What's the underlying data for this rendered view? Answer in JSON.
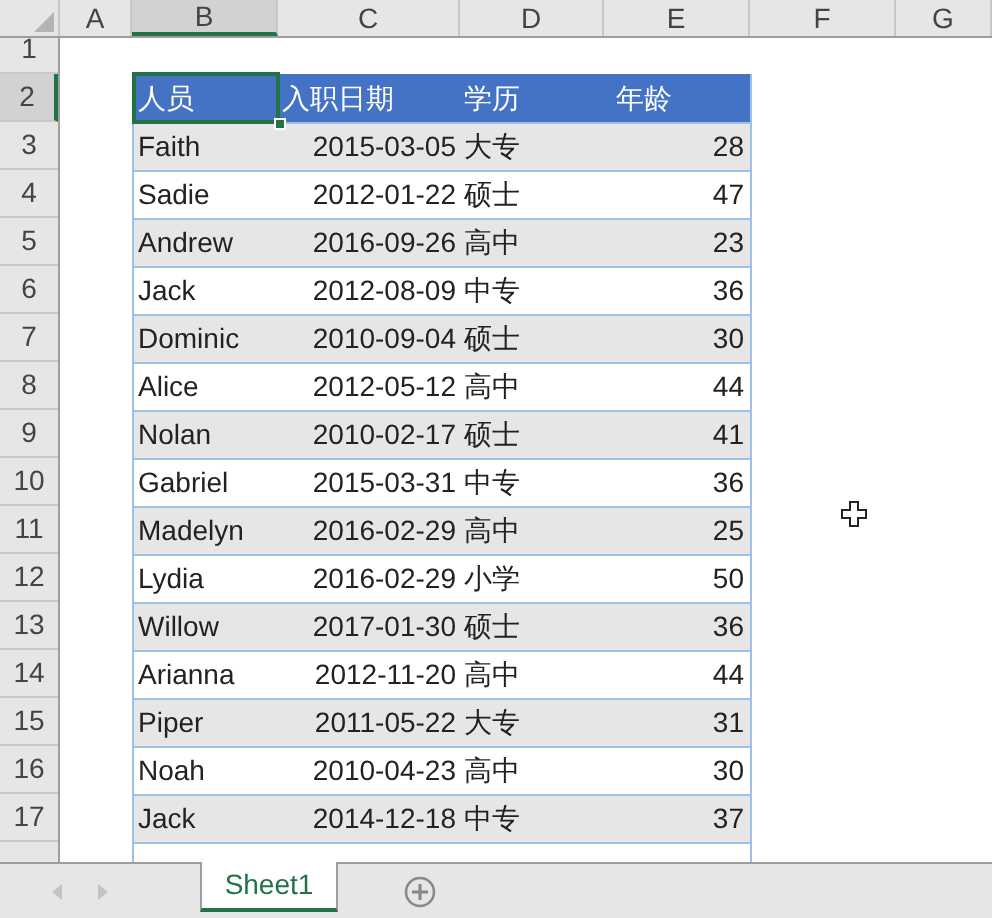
{
  "column_headers": [
    {
      "label": "A",
      "selected": false
    },
    {
      "label": "B",
      "selected": true
    },
    {
      "label": "C",
      "selected": false
    },
    {
      "label": "D",
      "selected": false
    },
    {
      "label": "E",
      "selected": false
    },
    {
      "label": "F",
      "selected": false
    },
    {
      "label": "G",
      "selected": false
    }
  ],
  "row_headers": [
    {
      "label": "1",
      "selected": false
    },
    {
      "label": "2",
      "selected": true
    },
    {
      "label": "3",
      "selected": false
    },
    {
      "label": "4",
      "selected": false
    },
    {
      "label": "5",
      "selected": false
    },
    {
      "label": "6",
      "selected": false
    },
    {
      "label": "7",
      "selected": false
    },
    {
      "label": "8",
      "selected": false
    },
    {
      "label": "9",
      "selected": false
    },
    {
      "label": "10",
      "selected": false
    },
    {
      "label": "11",
      "selected": false
    },
    {
      "label": "12",
      "selected": false
    },
    {
      "label": "13",
      "selected": false
    },
    {
      "label": "14",
      "selected": false
    },
    {
      "label": "15",
      "selected": false
    },
    {
      "label": "16",
      "selected": false
    },
    {
      "label": "17",
      "selected": false
    }
  ],
  "table": {
    "header": [
      {
        "text": "人员",
        "selected": true
      },
      {
        "text": "入职日期",
        "selected": false
      },
      {
        "text": "学历",
        "selected": false
      },
      {
        "text": "年龄",
        "selected": false
      }
    ],
    "rows": [
      [
        "Faith",
        "2015-03-05",
        "大专",
        "28"
      ],
      [
        "Sadie",
        "2012-01-22",
        "硕士",
        "47"
      ],
      [
        "Andrew",
        "2016-09-26",
        "高中",
        "23"
      ],
      [
        "Jack",
        "2012-08-09",
        "中专",
        "36"
      ],
      [
        "Dominic",
        "2010-09-04",
        "硕士",
        "30"
      ],
      [
        "Alice",
        "2012-05-12",
        "高中",
        "44"
      ],
      [
        "Nolan",
        "2010-02-17",
        "硕士",
        "41"
      ],
      [
        "Gabriel",
        "2015-03-31",
        "中专",
        "36"
      ],
      [
        "Madelyn",
        "2016-02-29",
        "高中",
        "25"
      ],
      [
        "Lydia",
        "2016-02-29",
        "小学",
        "50"
      ],
      [
        "Willow",
        "2017-01-30",
        "硕士",
        "36"
      ],
      [
        "Arianna",
        "2012-11-20",
        "高中",
        "44"
      ],
      [
        "Piper",
        "2011-05-22",
        "大专",
        "31"
      ],
      [
        "Noah",
        "2010-04-23",
        "高中",
        "30"
      ],
      [
        "Jack",
        "2014-12-18",
        "中专",
        "37"
      ]
    ]
  },
  "sheet_tabs": [
    {
      "label": "Sheet1",
      "selected": true
    }
  ],
  "nav_disabled": true
}
